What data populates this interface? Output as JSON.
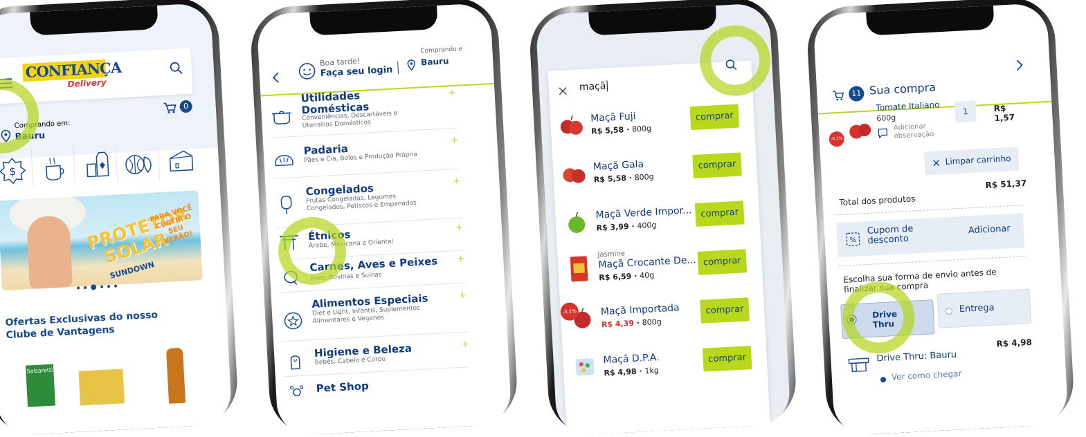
{
  "colors": {
    "brand_blue": "#17498f",
    "lime": "#b8d81c",
    "discount_red": "#d8322c",
    "logo_yellow": "#f4d21a"
  },
  "phone1": {
    "logo_title": "CONFIANÇA",
    "logo_subtitle": "Delivery",
    "cart_count": "0",
    "location_label": "Comprando em:",
    "location_city": "Bauru",
    "banner": {
      "line1": "PROTETOR",
      "line2": "SOLAR",
      "line3": "SUNDOWN",
      "tagline": "PARA VOCÊ CURTIR O SEU VERÃO!"
    },
    "section_title": "Ofertas Exclusivas do nosso Clube de Vantagens",
    "product_label": "Salsaretti"
  },
  "phone2": {
    "greeting": "Boa tarde!",
    "login": "Faça seu login",
    "buying_label": "Comprando e",
    "city": "Bauru",
    "categories": [
      {
        "title": "Utilidades Domésticas",
        "desc": "Conveniências, Descartáveis e Utensílios Domésticos",
        "icon": "pot-icon"
      },
      {
        "title": "Padaria",
        "desc": "Pães e Cia, Bolos e Produção Própria",
        "icon": "bread-icon"
      },
      {
        "title": "Congelados",
        "desc": "Frutas Congeladas, Legumes Congelados, Petiscos e Empanados",
        "icon": "popsicle-icon"
      },
      {
        "title": "Étnicos",
        "desc": "Árabe, Mexicana e Oriental",
        "icon": "torii-icon"
      },
      {
        "title": "Carnes, Aves e Peixes",
        "desc": "Aves, Bovinas e Suínas",
        "icon": "meat-icon"
      },
      {
        "title": "Alimentos Especiais",
        "desc": "Diet e Light, Infantis, Suplementos Alimentares e Veganos",
        "icon": "star-badge-icon"
      },
      {
        "title": "Higiene e Beleza",
        "desc": "Bebês, Cabelo e Corpo",
        "icon": "beauty-icon"
      },
      {
        "title": "Pet Shop",
        "desc": "",
        "icon": "paw-icon"
      }
    ]
  },
  "phone3": {
    "search_value": "maçã",
    "buy_label": "comprar",
    "products": [
      {
        "brand": "",
        "name": "Maçã Fuji",
        "price": "R$ 5,58",
        "unit": "800g",
        "discount": ""
      },
      {
        "brand": "",
        "name": "Maçã Gala",
        "price": "R$ 5,58",
        "unit": "800g",
        "discount": ""
      },
      {
        "brand": "",
        "name": "Maçã Verde Impor...",
        "price": "R$ 3,99",
        "unit": "400g",
        "discount": ""
      },
      {
        "brand": "Jasmine",
        "name": "Maçã Crocante De...",
        "price": "R$ 6,59",
        "unit": "40g",
        "discount": ""
      },
      {
        "brand": "",
        "name": "Maçã Importada",
        "price": "R$ 4,39",
        "unit": "800g",
        "discount": "-3,1%"
      },
      {
        "brand": "",
        "name": "Maçã D.P.A.",
        "price": "R$ 4,98",
        "unit": "1kg",
        "discount": ""
      }
    ]
  },
  "phone4": {
    "cart_count": "11",
    "title": "Sua compra",
    "item_name": "Tomate Italiano",
    "item_weight": "600g",
    "item_qty": "1",
    "item_price": "R$ 1,57",
    "item_discount": "-0,1%",
    "add_note": "Adicionar observação",
    "clear_cart": "Limpar carrinho",
    "total_label": "Total dos produtos",
    "total_value": "R$ 51,37",
    "coupon_label": "Cupom de desconto",
    "coupon_action": "Adicionar",
    "shipping_prompt": "Escolha sua forma de envio antes de finalizar sua compra",
    "option_drive": "Drive Thru",
    "option_delivery": "Entrega",
    "drive_label": "Drive Thru: Bauru",
    "drive_price": "R$ 4,98",
    "directions": "Ver como chegar"
  }
}
